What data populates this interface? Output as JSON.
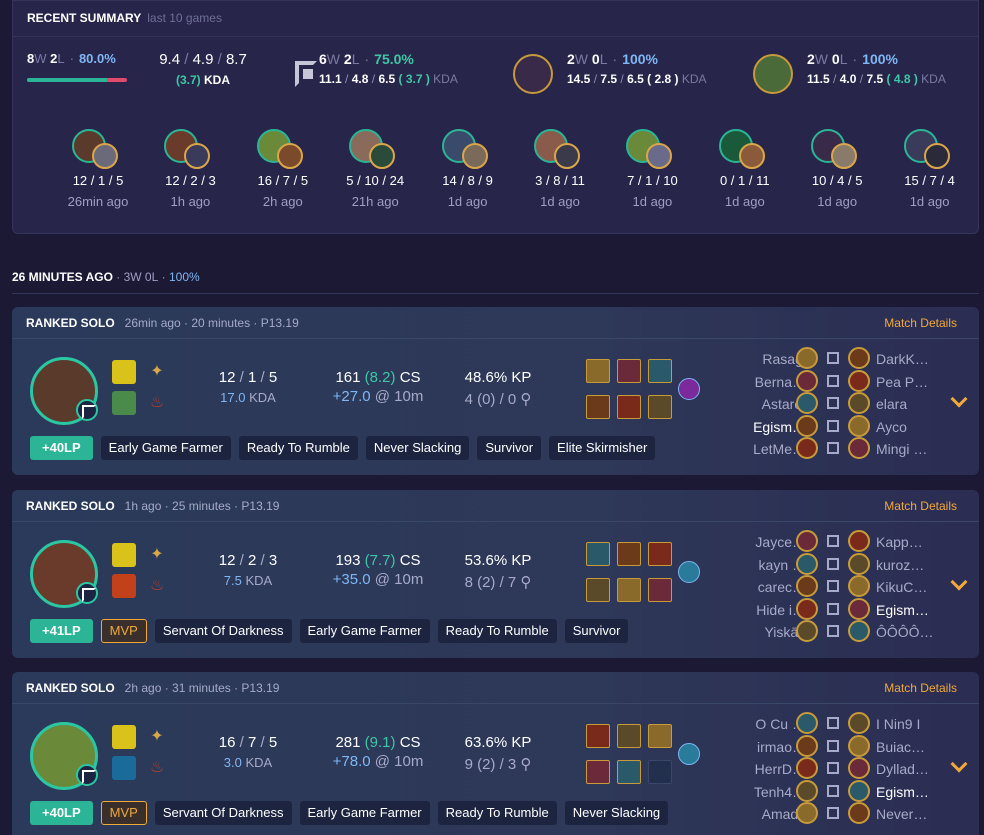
{
  "summary": {
    "title": "RECENT SUMMARY",
    "subtitle": "last 10 games",
    "overall": {
      "wins": "8",
      "losses": "2",
      "winrate": "80.0%",
      "winfrac": 0.8,
      "k": "9.4",
      "d": "4.9",
      "a": "8.7",
      "kda": "(3.7)",
      "kda_label": "KDA"
    },
    "role": {
      "icon": "middle-role-icon",
      "wins": "6",
      "losses": "2",
      "winrate": "75.0%",
      "k": "11.1",
      "d": "4.8",
      "a": "6.5",
      "kda": "( 3.7 )",
      "kda_label": "KDA"
    },
    "champs": [
      {
        "wins": "2",
        "losses": "0",
        "winrate": "100%",
        "k": "14.5",
        "d": "7.5",
        "a": "6.5",
        "kda": "( 2.8 )",
        "kda_label": "KDA",
        "color": "#3a2a4a"
      },
      {
        "wins": "2",
        "losses": "0",
        "winrate": "100%",
        "k": "11.5",
        "d": "4.0",
        "a": "7.5",
        "kda": "( 4.8 )",
        "kda_label": "KDA",
        "color": "#4a6a3a"
      }
    ],
    "games": [
      {
        "kda": "12 / 1 / 5",
        "time": "26min ago",
        "c1": "#5a3a2a",
        "c2": "#6a6a7a"
      },
      {
        "kda": "12 / 2 / 3",
        "time": "1h ago",
        "c1": "#6a3a2a",
        "c2": "#3a3a5a"
      },
      {
        "kda": "16 / 7 / 5",
        "time": "2h ago",
        "c1": "#6a8a3a",
        "c2": "#7a4a2a"
      },
      {
        "kda": "5 / 10 / 24",
        "time": "21h ago",
        "c1": "#8a6a5a",
        "c2": "#2a4a3a"
      },
      {
        "kda": "14 / 8 / 9",
        "time": "1d ago",
        "c1": "#3a4a6a",
        "c2": "#7a6a5a"
      },
      {
        "kda": "3 / 8 / 11",
        "time": "1d ago",
        "c1": "#8a5a4a",
        "c2": "#3a3a4a"
      },
      {
        "kda": "7 / 1 / 10",
        "time": "1d ago",
        "c1": "#6a8a3a",
        "c2": "#6a6a8a"
      },
      {
        "kda": "0 / 1 / 11",
        "time": "1d ago",
        "c1": "#1a5a3a",
        "c2": "#8a5a3a"
      },
      {
        "kda": "10 / 4 / 5",
        "time": "1d ago",
        "c1": "#3a2a4a",
        "c2": "#8a7a6a"
      },
      {
        "kda": "15 / 7 / 4",
        "time": "1d ago",
        "c1": "#3a3a5a",
        "c2": "#2a2a3a"
      }
    ]
  },
  "section": {
    "title": "26 MINUTES AGO",
    "record": "3W 0L",
    "sep": "·",
    "percent": "100%"
  },
  "matches": [
    {
      "queue": "RANKED SOLO",
      "meta": "26min ago · 20 minutes · ",
      "patch": "P13.19",
      "details": "Match Details",
      "k": "12",
      "d": "1",
      "a": "5",
      "kda": "17.0",
      "kda_label": "KDA",
      "cs": "161",
      "csm": "(8.2)",
      "cs_label": "CS",
      "diff": "+27.0",
      "at": "@ 10m",
      "kp": "48.6% KP",
      "ward": "4 (0) / 0",
      "tags": [
        {
          "t": "+40LP",
          "c": "lp"
        },
        {
          "t": "Early Game Farmer",
          "c": ""
        },
        {
          "t": "Ready To Rumble",
          "c": ""
        },
        {
          "t": "Never Slacking",
          "c": ""
        },
        {
          "t": "Survivor",
          "c": ""
        },
        {
          "t": "Elite Skirmisher",
          "c": ""
        }
      ],
      "champ": "#5a3a2a",
      "blue": [
        {
          "n": "Rasagi",
          "me": false
        },
        {
          "n": "Berna…",
          "me": false
        },
        {
          "n": "Astarot",
          "me": false
        },
        {
          "n": "Egism…",
          "me": true
        },
        {
          "n": "LetMe…",
          "me": false
        }
      ],
      "red": [
        {
          "n": "DarkK…",
          "me": false
        },
        {
          "n": "Pea P…",
          "me": false
        },
        {
          "n": "elara",
          "me": false
        },
        {
          "n": "Ayco",
          "me": false
        },
        {
          "n": "Mingi …",
          "me": false
        }
      ]
    },
    {
      "queue": "RANKED SOLO",
      "meta": "1h ago · 25 minutes · ",
      "patch": "P13.19",
      "details": "Match Details",
      "k": "12",
      "d": "2",
      "a": "3",
      "kda": "7.5",
      "kda_label": "KDA",
      "cs": "193",
      "csm": "(7.7)",
      "cs_label": "CS",
      "diff": "+35.0",
      "at": "@ 10m",
      "kp": "53.6% KP",
      "ward": "8 (2) / 7",
      "tags": [
        {
          "t": "+41LP",
          "c": "lp"
        },
        {
          "t": "MVP",
          "c": "mvp"
        },
        {
          "t": "Servant Of Darkness",
          "c": ""
        },
        {
          "t": "Early Game Farmer",
          "c": ""
        },
        {
          "t": "Ready To Rumble",
          "c": ""
        },
        {
          "t": "Survivor",
          "c": ""
        }
      ],
      "champ": "#6a3a2a",
      "blue": [
        {
          "n": "Jayce…",
          "me": false
        },
        {
          "n": "kayn …",
          "me": false
        },
        {
          "n": "carec…",
          "me": false
        },
        {
          "n": "Hide i…",
          "me": false
        },
        {
          "n": "Yiskāh",
          "me": false
        }
      ],
      "red": [
        {
          "n": "Kapp…",
          "me": false
        },
        {
          "n": "kuroz…",
          "me": false
        },
        {
          "n": "KikuC…",
          "me": false
        },
        {
          "n": "Egism…",
          "me": true
        },
        {
          "n": "ÔÔÔÔ…",
          "me": false
        }
      ]
    },
    {
      "queue": "RANKED SOLO",
      "meta": "2h ago · 31 minutes · ",
      "patch": "P13.19",
      "details": "Match Details",
      "k": "16",
      "d": "7",
      "a": "5",
      "kda": "3.0",
      "kda_label": "KDA",
      "cs": "281",
      "csm": "(9.1)",
      "cs_label": "CS",
      "diff": "+78.0",
      "at": "@ 10m",
      "kp": "63.6% KP",
      "ward": "9 (2) / 3",
      "tags": [
        {
          "t": "+40LP",
          "c": "lp"
        },
        {
          "t": "MVP",
          "c": "mvp"
        },
        {
          "t": "Servant Of Darkness",
          "c": ""
        },
        {
          "t": "Early Game Farmer",
          "c": ""
        },
        {
          "t": "Ready To Rumble",
          "c": ""
        },
        {
          "t": "Never Slacking",
          "c": ""
        }
      ],
      "champ": "#6a8a3a",
      "blue": [
        {
          "n": "O Cu …",
          "me": false
        },
        {
          "n": "irmao…",
          "me": false
        },
        {
          "n": "HerrD…",
          "me": false
        },
        {
          "n": "Tenh4…",
          "me": false
        },
        {
          "n": "Amada",
          "me": false
        }
      ],
      "red": [
        {
          "n": "I Nin9 I",
          "me": false
        },
        {
          "n": "Buiac…",
          "me": false
        },
        {
          "n": "Dyllad…",
          "me": false
        },
        {
          "n": "Egism…",
          "me": true
        },
        {
          "n": "Never…",
          "me": false
        }
      ]
    }
  ]
}
